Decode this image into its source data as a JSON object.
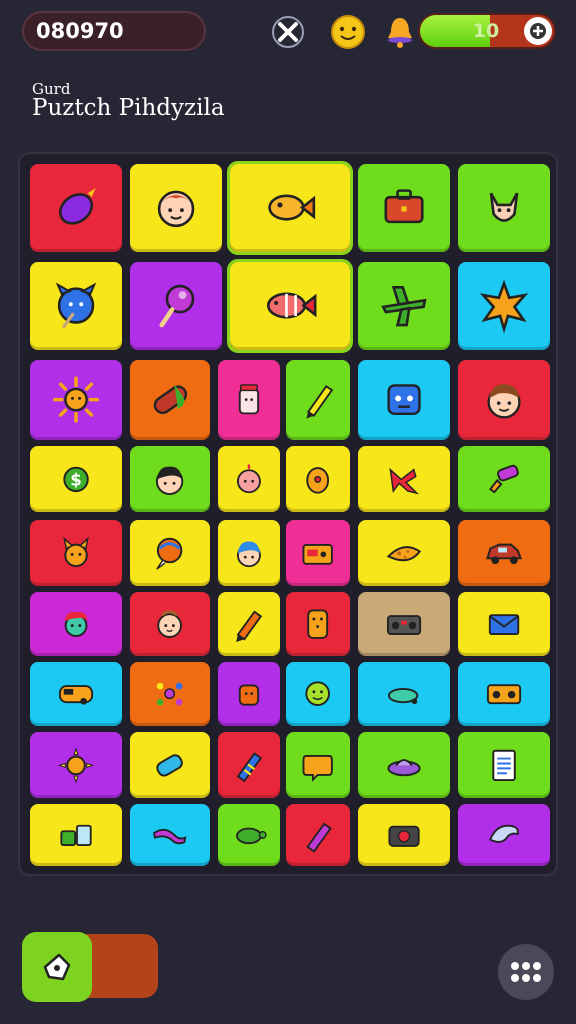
{
  "header": {
    "score": "080970",
    "energy_value": "10",
    "energy_level": 0.52
  },
  "title_block": {
    "subtitle": "Gurd",
    "title": "Puztch Pihdyzila"
  },
  "colors": {
    "red": "#e8283a",
    "yellow": "#f7e619",
    "lime": "#6fdc1c",
    "cyan": "#1cc9f2",
    "purple": "#b12fe8",
    "orange": "#f06c12",
    "pink": "#ef2f95",
    "tan": "#c9a978",
    "magenta": "#cc29d6"
  },
  "grid": [
    [
      {
        "bg": "red",
        "icon": "eggplant-icon"
      },
      {
        "bg": "yellow",
        "icon": "girl-face-icon"
      },
      {
        "bg": "yellow",
        "icon": "fish-icon"
      },
      {
        "bg": "lime",
        "icon": "briefcase-icon"
      },
      {
        "bg": "lime",
        "icon": "kangaroo-icon"
      }
    ],
    [
      {
        "bg": "yellow",
        "icon": "blue-cat-icon"
      },
      {
        "bg": "purple",
        "icon": "lollipop-icon"
      },
      {
        "bg": "yellow",
        "icon": "clownfish-icon"
      },
      {
        "bg": "lime",
        "icon": "airplane-icon"
      },
      {
        "bg": "cyan",
        "icon": "star-burst-icon"
      }
    ],
    [
      {
        "bg": "purple",
        "icon": "sun-icon"
      },
      {
        "bg": "orange",
        "icon": "pill-icon"
      },
      {
        "bg": "pink",
        "icon": "jar-icon"
      },
      {
        "bg": "lime",
        "icon": "pencil-icon"
      },
      {
        "bg": "cyan",
        "icon": "robot-icon"
      },
      {
        "bg": "red",
        "icon": "boy-face-icon"
      }
    ],
    [
      {
        "bg": "yellow",
        "icon": "coin-icon"
      },
      {
        "bg": "lime",
        "icon": "kid-face-icon"
      },
      {
        "bg": "yellow",
        "icon": "baby-face-icon"
      },
      {
        "bg": "yellow",
        "icon": "egg-icon"
      },
      {
        "bg": "yellow",
        "icon": "shoe-icon"
      },
      {
        "bg": "lime",
        "icon": "brush-icon"
      }
    ],
    [
      {
        "bg": "red",
        "icon": "dog-icon"
      },
      {
        "bg": "yellow",
        "icon": "balloon-icon"
      },
      {
        "bg": "yellow",
        "icon": "boy-blue-icon"
      },
      {
        "bg": "pink",
        "icon": "radio-icon"
      },
      {
        "bg": "yellow",
        "icon": "cheese-icon"
      },
      {
        "bg": "orange",
        "icon": "car-icon"
      }
    ],
    [
      {
        "bg": "magenta",
        "icon": "monster-icon"
      },
      {
        "bg": "red",
        "icon": "baby-icon"
      },
      {
        "bg": "yellow",
        "icon": "crayon-icon"
      },
      {
        "bg": "red",
        "icon": "cracker-icon"
      },
      {
        "bg": "tan",
        "icon": "boombox-icon"
      },
      {
        "bg": "yellow",
        "icon": "envelope-icon"
      }
    ],
    [
      {
        "bg": "cyan",
        "icon": "bus-icon"
      },
      {
        "bg": "orange",
        "icon": "molecule-icon"
      },
      {
        "bg": "purple",
        "icon": "kettle-icon"
      },
      {
        "bg": "cyan",
        "icon": "smiley-icon"
      },
      {
        "bg": "cyan",
        "icon": "submarine-icon"
      },
      {
        "bg": "cyan",
        "icon": "stereo-icon"
      }
    ],
    [
      {
        "bg": "purple",
        "icon": "sunflower-icon"
      },
      {
        "bg": "yellow",
        "icon": "can-icon"
      },
      {
        "bg": "red",
        "icon": "crayon-striped-icon"
      },
      {
        "bg": "lime",
        "icon": "chat-bubble-icon"
      },
      {
        "bg": "lime",
        "icon": "ufo-icon"
      },
      {
        "bg": "lime",
        "icon": "notepad-icon"
      }
    ],
    [
      {
        "bg": "yellow",
        "icon": "gadgets-icon"
      },
      {
        "bg": "cyan",
        "icon": "lizard-icon"
      },
      {
        "bg": "lime",
        "icon": "turtle-icon"
      },
      {
        "bg": "red",
        "icon": "marker-icon"
      },
      {
        "bg": "yellow",
        "icon": "camera-icon"
      },
      {
        "bg": "purple",
        "icon": "dolphin-icon"
      }
    ]
  ]
}
